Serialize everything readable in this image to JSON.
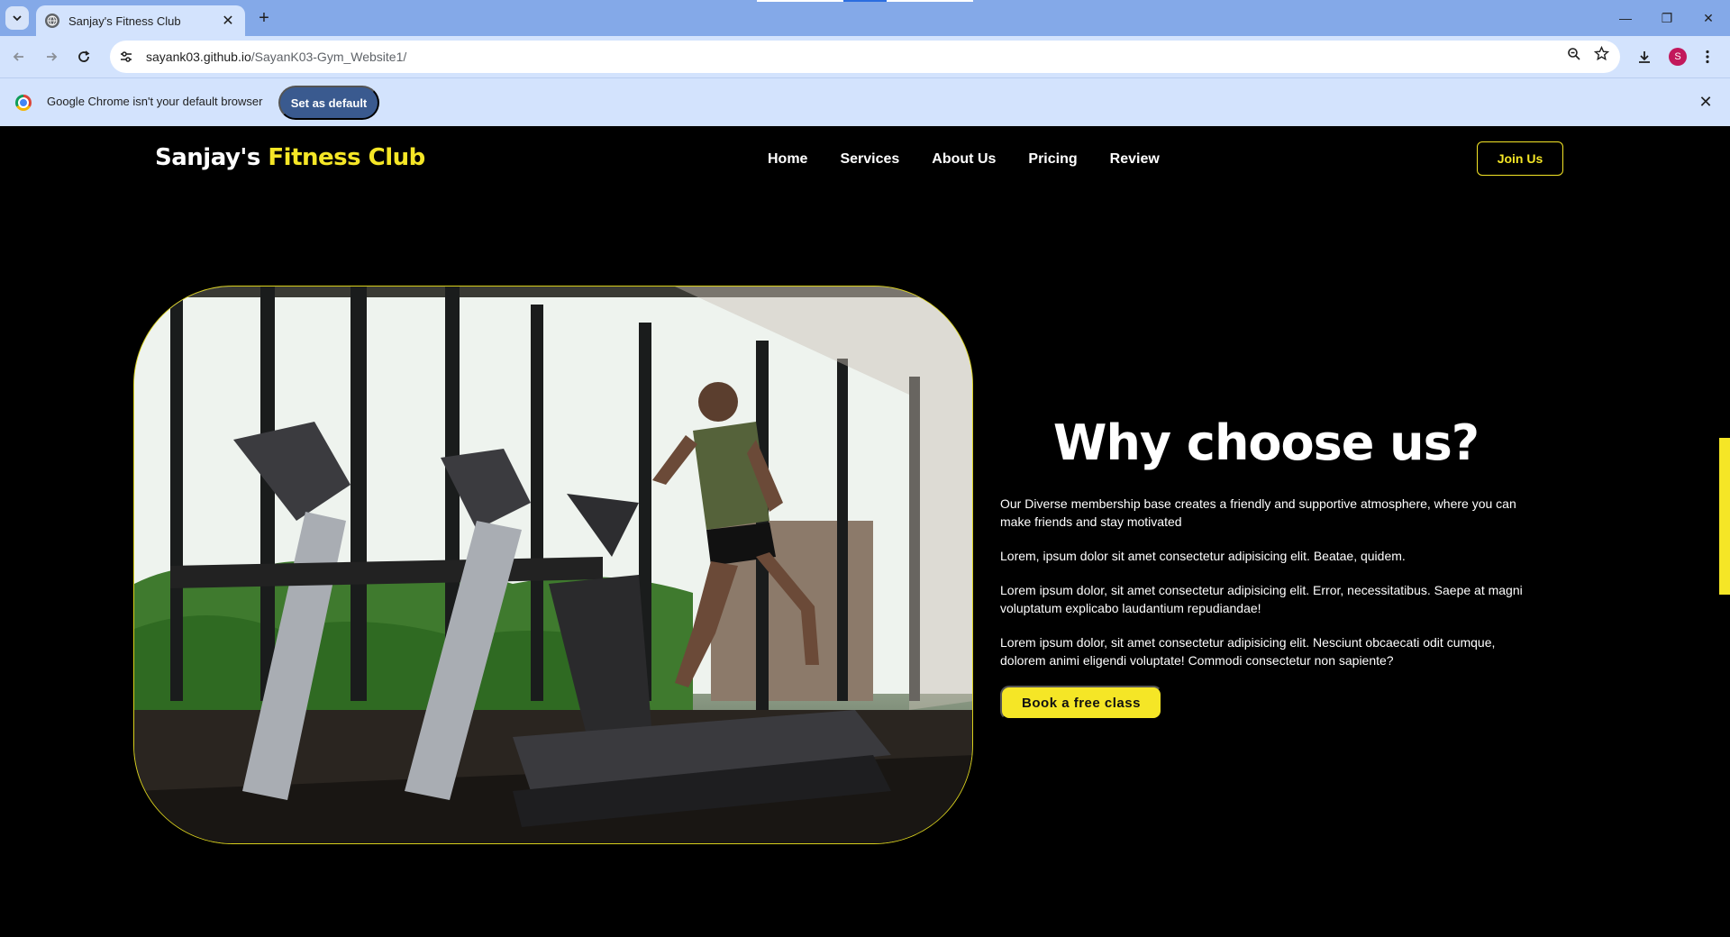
{
  "browser": {
    "tab_title": "Sanjay's Fitness Club",
    "url_host": "sayank03.github.io",
    "url_path": "/SayanK03-Gym_Website1/",
    "avatar_letter": "S",
    "infobar_message": "Google Chrome isn't your default browser",
    "set_default_label": "Set as default",
    "icons": {
      "tab_search": "chevron-down-icon",
      "favicon": "globe-icon",
      "tab_close": "close-icon",
      "new_tab": "plus-icon",
      "back": "arrow-left-icon",
      "forward": "arrow-right-icon",
      "reload": "reload-icon",
      "site_info": "tune-icon",
      "zoom": "zoom-icon",
      "bookmark": "star-icon",
      "download": "download-icon",
      "menu": "kebab-menu-icon"
    }
  },
  "site": {
    "logo_primary": "Sanjay's",
    "logo_accent": "Fitness Club",
    "nav": [
      "Home",
      "Services",
      "About Us",
      "Pricing",
      "Review"
    ],
    "join_label": "Join Us",
    "accent_color": "#f5e626"
  },
  "why": {
    "title": "Why choose us?",
    "paragraphs": [
      "Our Diverse membership base creates a friendly and supportive atmosphere, where you can make friends and stay motivated",
      "Lorem, ipsum dolor sit amet consectetur adipisicing elit. Beatae, quidem.",
      "Lorem ipsum dolor, sit amet consectetur adipisicing elit. Error, necessitatibus. Saepe at magni voluptatum explicabo laudantium repudiandae!",
      "Lorem ipsum dolor, sit amet consectetur adipisicing elit. Nesciunt obcaecati odit cumque, dolorem animi eligendi voluptate! Commodi consectetur non sapiente?"
    ],
    "cta_label": "Book a free class"
  }
}
